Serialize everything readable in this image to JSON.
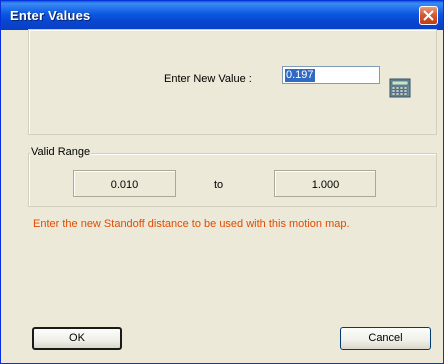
{
  "window": {
    "title": "Enter Values"
  },
  "input": {
    "label": "Enter New Value :",
    "value": "0.197"
  },
  "valid_range": {
    "caption": "Valid Range",
    "min": "0.010",
    "separator": "to",
    "max": "1.000"
  },
  "info_text": "Enter the new Standoff distance to be used with this motion map.",
  "buttons": {
    "ok": "OK",
    "cancel": "Cancel"
  },
  "icons": {
    "close": "close-icon",
    "calculator": "calculator-icon"
  },
  "colors": {
    "title_bar": "#0a4fd6",
    "info_text": "#e24a00",
    "selection": "#316ac5"
  }
}
